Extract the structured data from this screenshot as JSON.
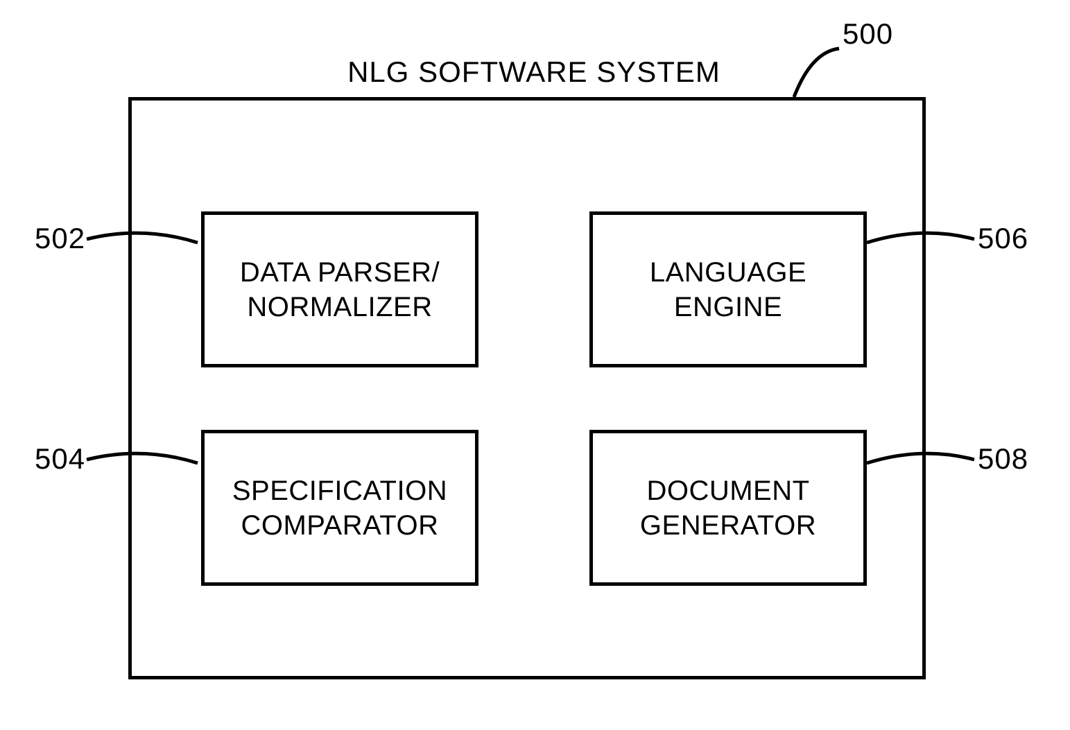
{
  "diagram": {
    "title": "NLG SOFTWARE SYSTEM",
    "labels": {
      "outer": "500",
      "topLeft": "502",
      "bottomLeft": "504",
      "topRight": "506",
      "bottomRight": "508"
    },
    "boxes": {
      "topLeft": {
        "line1": "DATA PARSER/",
        "line2": "NORMALIZER"
      },
      "topRight": {
        "line1": "LANGUAGE",
        "line2": "ENGINE"
      },
      "bottomLeft": {
        "line1": "SPECIFICATION",
        "line2": "COMPARATOR"
      },
      "bottomRight": {
        "line1": "DOCUMENT",
        "line2": "GENERATOR"
      }
    }
  }
}
